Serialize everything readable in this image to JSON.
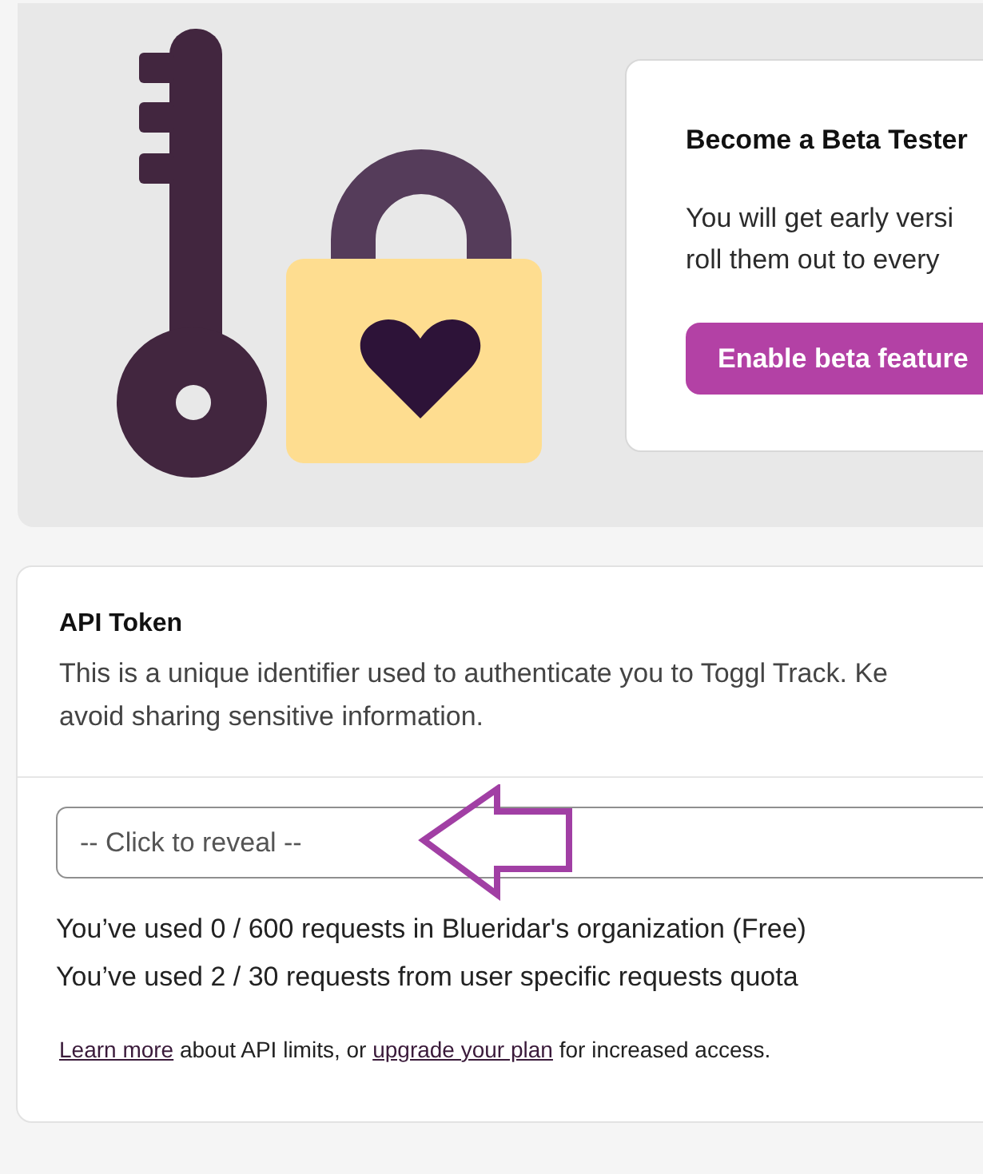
{
  "beta_card": {
    "title": "Become a Beta Tester",
    "lines": [
      "You will get early versi",
      "roll them out to every"
    ],
    "button": "Enable beta feature"
  },
  "api_token": {
    "title": "API Token",
    "description": [
      "This is a unique identifier used to authenticate you to Toggl Track. Ke",
      "avoid sharing sensitive information."
    ],
    "field": {
      "placeholder": "-- Click to reveal --"
    },
    "usage": [
      "You’ve used 0 / 600 requests in Blueridar's organization (Free)",
      "You’ve used 2 / 30 requests from user specific requests quota"
    ],
    "footer": [
      {
        "kind": "link",
        "text": "Learn more"
      },
      {
        "kind": "text",
        "text": " about API limits, or "
      },
      {
        "kind": "link",
        "text": "upgrade your plan"
      },
      {
        "kind": "text",
        "text": " for increased access."
      }
    ]
  }
}
